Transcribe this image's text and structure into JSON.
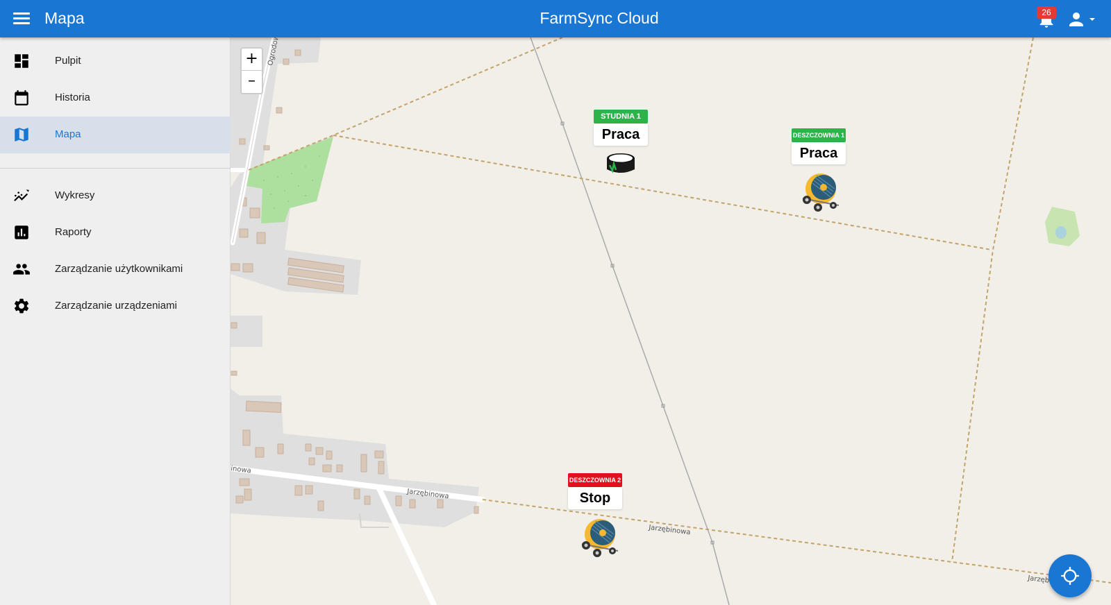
{
  "header": {
    "title": "Mapa",
    "app_name": "FarmSync Cloud",
    "notification_count": "26"
  },
  "sidebar": {
    "items": [
      {
        "label": "Pulpit",
        "icon": "dashboard-icon"
      },
      {
        "label": "Historia",
        "icon": "calendar-icon"
      },
      {
        "label": "Mapa",
        "icon": "map-icon",
        "active": true
      },
      {
        "label": "Wykresy",
        "icon": "line-chart-icon"
      },
      {
        "label": "Raporty",
        "icon": "report-icon"
      },
      {
        "label": "Zarządzanie użytkownikami",
        "icon": "users-icon"
      },
      {
        "label": "Zarządzanie urządzeniami",
        "icon": "gear-icon"
      }
    ]
  },
  "map": {
    "zoom_in": "+",
    "zoom_out": "–",
    "street_labels": [
      "Ogrodowa",
      "Jarzębinowa",
      "Jarzębinowa",
      "inowa",
      "Jarzęb"
    ],
    "markers": [
      {
        "name": "STUDNIA 1",
        "status": "Praca",
        "status_color": "#2eb34a",
        "device": "well"
      },
      {
        "name": "DESZCZOWNIA 1",
        "status": "Praca",
        "status_color": "#2eb34a",
        "device": "hose-reel"
      },
      {
        "name": "DESZCZOWNIA 2",
        "status": "Stop",
        "status_color": "#e3101f",
        "device": "hose-reel"
      }
    ]
  },
  "colors": {
    "primary": "#1976d2",
    "sidebar_bg": "#efefef",
    "active_bg": "#d6dfea",
    "map_bg": "#f2efe9",
    "working": "#2eb34a",
    "stopped": "#e3101f"
  }
}
